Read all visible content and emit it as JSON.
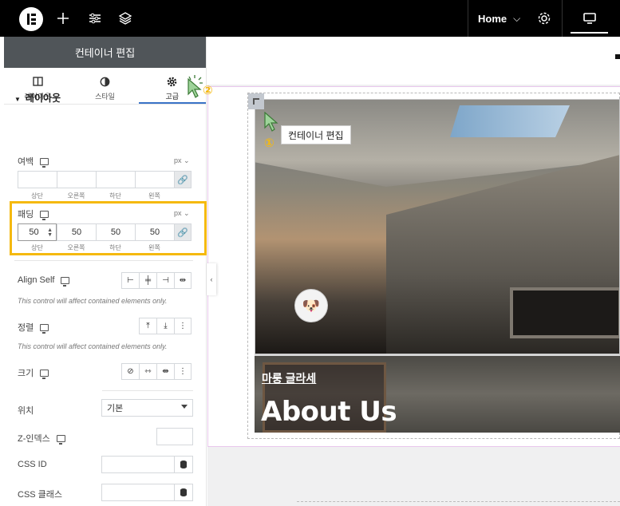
{
  "topbar": {
    "home_label": "Home",
    "home_chevron": "⌵"
  },
  "panel": {
    "header": "컨테이너 편집",
    "tabs": [
      {
        "label": "레이아웃",
        "icon": "layout-icon"
      },
      {
        "label": "스타일",
        "icon": "style-icon"
      },
      {
        "label": "고급",
        "icon": "gear-icon",
        "active": true
      }
    ],
    "section": "레이아웃",
    "margin": {
      "label": "여백",
      "unit": "px ⌄",
      "values": [
        "",
        "",
        "",
        ""
      ],
      "sublabels": [
        "상단",
        "오른쪽",
        "하단",
        "왼쪽"
      ]
    },
    "padding": {
      "label": "패딩",
      "unit": "px ⌄",
      "values": [
        "50",
        "50",
        "50",
        "50"
      ],
      "sublabels": [
        "상단",
        "오른쪽",
        "하단",
        "왼쪽"
      ]
    },
    "align_self": {
      "label": "Align Self",
      "note": "This control will affect contained elements only."
    },
    "order": {
      "label": "정렬",
      "note": "This control will affect contained elements only."
    },
    "size": {
      "label": "크기"
    },
    "position": {
      "label": "위치",
      "value": "기본"
    },
    "zindex": {
      "label": "Z-인덱스",
      "value": ""
    },
    "css_id": {
      "label": "CSS ID",
      "value": ""
    },
    "css_class": {
      "label": "CSS 클래스",
      "value": ""
    }
  },
  "canvas": {
    "tooltip": "컨테이너 편집",
    "brand": "마룽 글라세",
    "heading": "About Us"
  },
  "markers": {
    "one": "①",
    "two": "②"
  },
  "colors": {
    "accent": "#3a73c7",
    "highlight": "#f5b90f",
    "panel_header": "#505559"
  }
}
